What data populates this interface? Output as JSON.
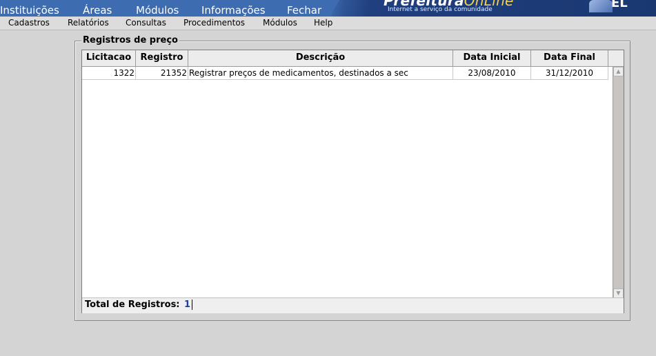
{
  "topnav": {
    "items": [
      "Instituições",
      "Áreas",
      "Módulos",
      "Informações",
      "Fechar"
    ],
    "brand_prefix": "Prefeitura",
    "brand_accent": "OnLine",
    "brand_subtitle": "Internet a serviço da comunidade",
    "corner_text": "EL"
  },
  "menubar": {
    "items": [
      "Cadastros",
      "Relatórios",
      "Consultas",
      "Procedimentos",
      "Módulos",
      "Help"
    ]
  },
  "group": {
    "title": "Registros de preço"
  },
  "table": {
    "columns": [
      "Licitacao",
      "Registro",
      "Descrição",
      "Data Inicial",
      "Data Final"
    ],
    "rows": [
      [
        "1322",
        "21352",
        "Registrar preços de medicamentos, destinados a sec",
        "23/08/2010",
        "31/12/2010"
      ]
    ]
  },
  "footer": {
    "label": "Total de Registros:",
    "value": "1"
  },
  "colors": {
    "topbar": "#3e6cb1",
    "background": "#d4d4d4",
    "count_value": "#1a3ea8"
  }
}
